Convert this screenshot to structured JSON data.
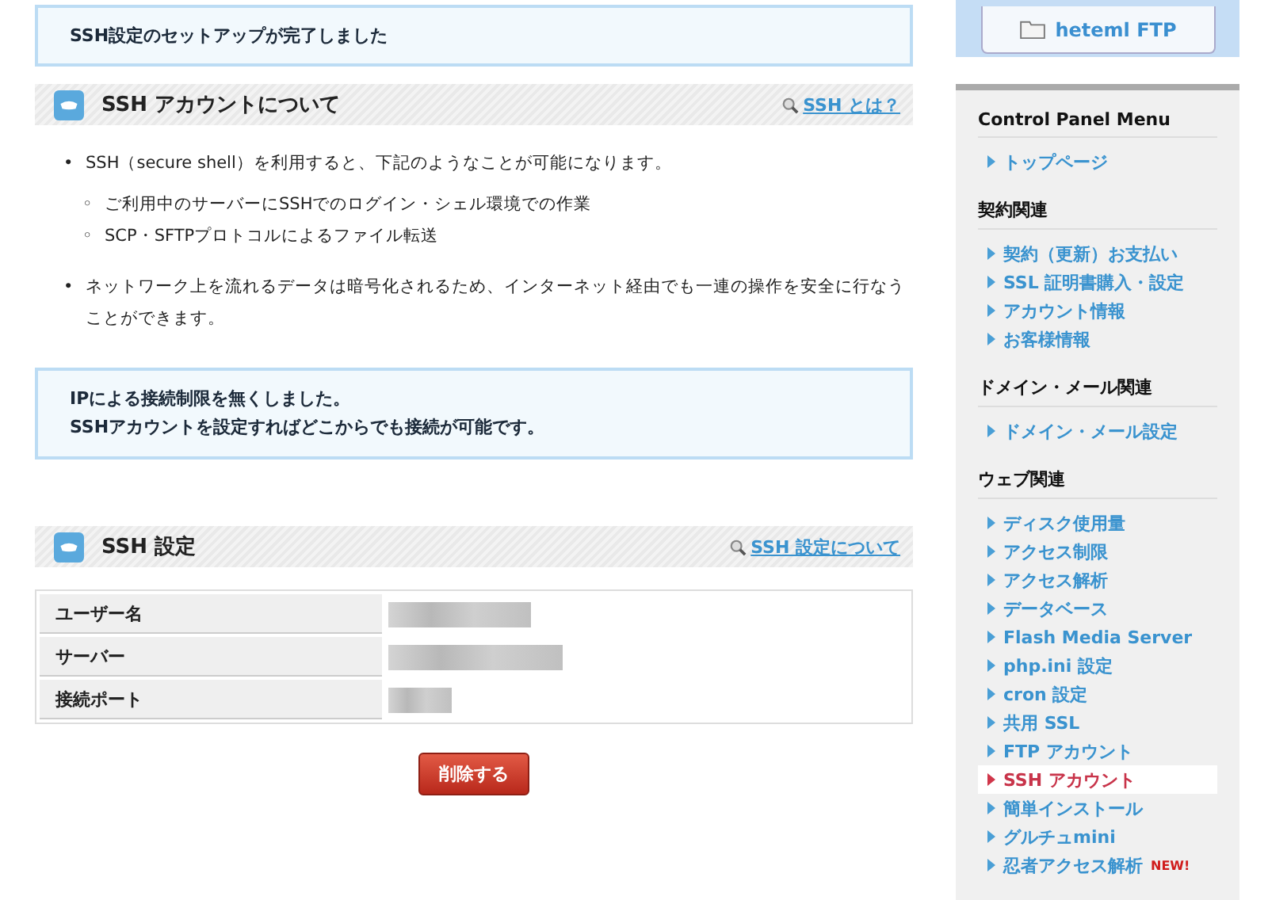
{
  "notice_top": {
    "text": "SSH設定のセットアップが完了しました"
  },
  "about_section": {
    "title": "SSH アカウントについて",
    "help_link": "SSH とは？",
    "bullets": [
      {
        "marker": "•",
        "text": "SSH（secure shell）を利用すると、下記のようなことが可能になります。",
        "children": [
          {
            "marker": "◦",
            "text": "ご利用中のサーバーにSSHでのログイン・シェル環境での作業"
          },
          {
            "marker": "◦",
            "text": "SCP・SFTPプロトコルによるファイル転送"
          }
        ]
      },
      {
        "marker": "•",
        "text": "ネットワーク上を流れるデータは暗号化されるため、インターネット経由でも一連の操作を安全に行なうことができます。"
      }
    ]
  },
  "notice_ip": {
    "lines": [
      "IPによる接続制限を無くしました。",
      "SSHアカウントを設定すればどこからでも接続が可能です。"
    ]
  },
  "settings_section": {
    "title": "SSH 設定",
    "help_link": "SSH 設定について",
    "rows": [
      {
        "label": "ユーザー名"
      },
      {
        "label": "サーバー"
      },
      {
        "label": "接続ポート"
      }
    ],
    "delete_button": "削除する"
  },
  "sidebar": {
    "ftp_button": "heteml FTP",
    "menu_title": "Control Panel Menu",
    "groups": [
      {
        "items": [
          {
            "label": "トップページ",
            "selected": false
          }
        ]
      },
      {
        "heading": "契約関連",
        "items": [
          {
            "label": "契約（更新）お支払い",
            "selected": false
          },
          {
            "label": "SSL 証明書購入・設定",
            "selected": false
          },
          {
            "label": "アカウント情報",
            "selected": false
          },
          {
            "label": "お客様情報",
            "selected": false
          }
        ]
      },
      {
        "heading": "ドメイン・メール関連",
        "items": [
          {
            "label": "ドメイン・メール設定",
            "selected": false
          }
        ]
      },
      {
        "heading": "ウェブ関連",
        "items": [
          {
            "label": "ディスク使用量",
            "selected": false
          },
          {
            "label": "アクセス制限",
            "selected": false
          },
          {
            "label": "アクセス解析",
            "selected": false
          },
          {
            "label": "データベース",
            "selected": false
          },
          {
            "label": "Flash Media Server",
            "selected": false
          },
          {
            "label": "php.ini 設定",
            "selected": false
          },
          {
            "label": "cron 設定",
            "selected": false
          },
          {
            "label": "共用 SSL",
            "selected": false
          },
          {
            "label": "FTP アカウント",
            "selected": false
          },
          {
            "label": "SSH アカウント",
            "selected": true
          },
          {
            "label": "簡単インストール",
            "selected": false
          },
          {
            "label": "グルチュmini",
            "selected": false
          },
          {
            "label": "忍者アクセス解析",
            "selected": false,
            "badge": "NEW!"
          }
        ]
      }
    ]
  }
}
